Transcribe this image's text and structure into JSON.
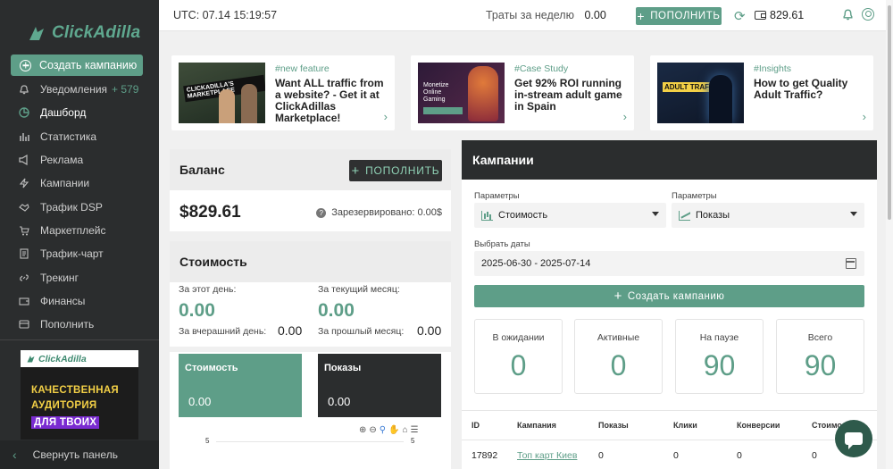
{
  "brand": {
    "logo_text": "ClickAdilla"
  },
  "sidebar": {
    "create_label": "Создать кампанию",
    "items": [
      {
        "label": "Уведомления",
        "icon": "bell-icon",
        "count": "+ 579"
      },
      {
        "label": "Дашборд",
        "icon": "dashboard-icon"
      },
      {
        "label": "Статистика",
        "icon": "bar-chart-icon"
      },
      {
        "label": "Реклама",
        "icon": "megaphone-icon"
      },
      {
        "label": "Кампании",
        "icon": "lightning-icon"
      },
      {
        "label": "Трафик DSP",
        "icon": "handshake-icon"
      },
      {
        "label": "Маркетплейс",
        "icon": "cart-icon"
      },
      {
        "label": "Трафик-чарт",
        "icon": "document-icon"
      },
      {
        "label": "Трекинг",
        "icon": "link-icon"
      },
      {
        "label": "Финансы",
        "icon": "wallet-icon"
      },
      {
        "label": "Пополнить",
        "icon": "card-icon"
      }
    ],
    "promo": {
      "logo": "ClickAdilla",
      "line1": "КАЧЕСТВЕННАЯ",
      "line2": "АУДИТОРИЯ",
      "line3": "ДЛЯ ТВОИХ"
    },
    "collapse_label": "Свернуть панель"
  },
  "topbar": {
    "utc": "UTC: 07.14 15:19:57",
    "weekly_label": "Траты за неделю",
    "weekly_value": "0.00",
    "deposit_label": "ПОПОЛНИТЬ",
    "balance": "829.61"
  },
  "news": [
    {
      "tag": "#new feature",
      "title": "Want ALL traffic from a website? - Get it at ClickAdillas Marketplace!",
      "thumb_text": "CLICKADILLA'S MARKETPLACE"
    },
    {
      "tag": "#Case Study",
      "title": "Get 92% ROI running in-stream adult game in Spain",
      "thumb_text": "Monetize Online Gaming"
    },
    {
      "tag": "#Insights",
      "title": "How to get Quality Adult Traffic?",
      "thumb_text": "ADULT TRAFFIC"
    }
  ],
  "balance": {
    "title": "Баланс",
    "deposit_label": "ПОПОЛНИТЬ",
    "amount": "$829.61",
    "reserved": "Зарезервировано: 0.00$"
  },
  "cost": {
    "title": "Стоимость",
    "today_label": "За этот день:",
    "today_value": "0.00",
    "month_label": "За текущий месяц:",
    "month_value": "0.00",
    "yesterday_label": "За вчерашний день:",
    "yesterday_value": "0.00",
    "lastmonth_label": "За прошлый месяц:",
    "lastmonth_value": "0.00"
  },
  "mini_cards": [
    {
      "title": "Стоимость",
      "value": "0.00"
    },
    {
      "title": "Показы",
      "value": "0.00"
    }
  ],
  "chart_axis": {
    "left": "5",
    "right": "5"
  },
  "campaigns": {
    "title": "Кампании",
    "param1_label": "Параметры",
    "param1_value": "Стоимость",
    "param2_label": "Параметры",
    "param2_value": "Показы",
    "date_label": "Выбрать даты",
    "date_value": "2025-06-30 - 2025-07-14",
    "create_label": "Создать кампанию",
    "stats": [
      {
        "label": "В ожидании",
        "value": "0"
      },
      {
        "label": "Активные",
        "value": "0"
      },
      {
        "label": "На паузе",
        "value": "90"
      },
      {
        "label": "Всего",
        "value": "90"
      }
    ],
    "table": {
      "columns": [
        "ID",
        "Кампания",
        "Показы",
        "Клики",
        "Конверсии",
        "Стоимость"
      ],
      "rows": [
        {
          "id": "17892",
          "name": "Топ карт Киев",
          "impressions": "0",
          "clicks": "0",
          "conversions": "0",
          "cost": "0"
        }
      ]
    }
  },
  "colors": {
    "accent": "#5e9e88",
    "sidebar": "#2b2d2e",
    "background": "#f0f0f0"
  }
}
